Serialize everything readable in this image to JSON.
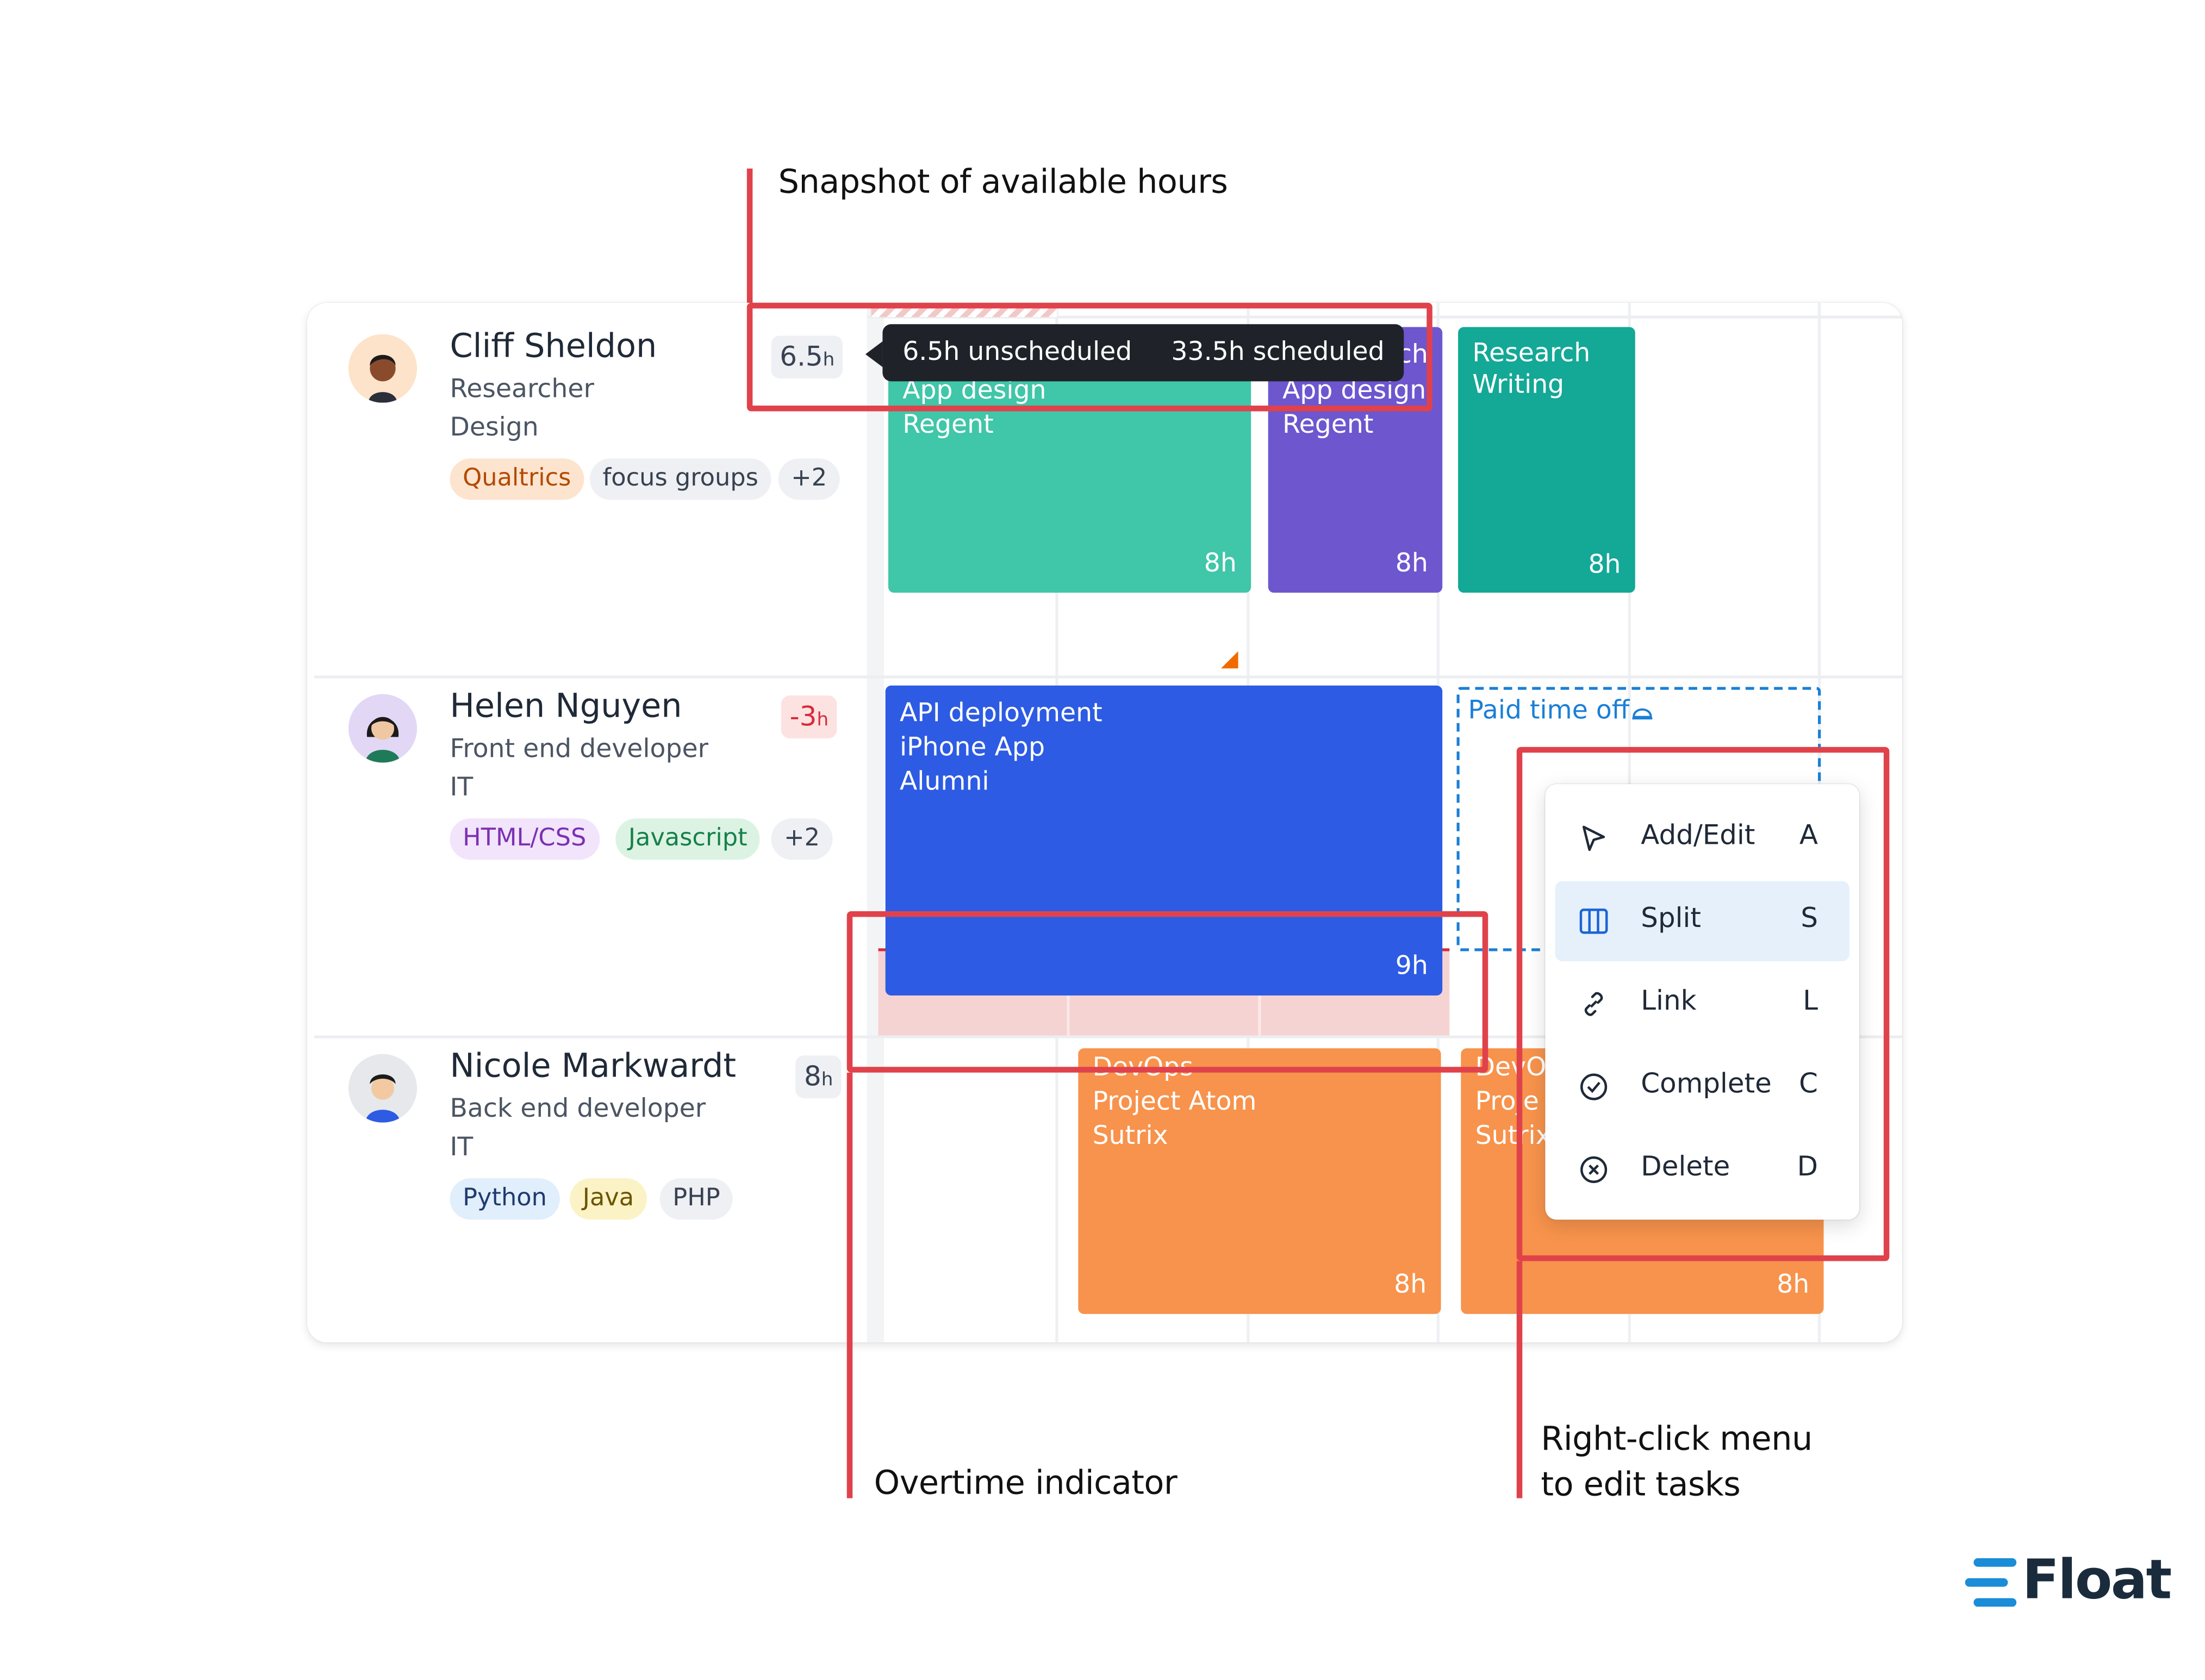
{
  "annotations": {
    "available_hours": "Snapshot of available hours",
    "overtime": "Overtime indicator",
    "right_click_line1": "Right-click menu",
    "right_click_line2": "to edit tasks"
  },
  "tooltip": {
    "unscheduled": "6.5h unscheduled",
    "scheduled": "33.5h scheduled"
  },
  "people": [
    {
      "name": "Cliff Sheldon",
      "role": "Researcher",
      "department": "Design",
      "hours_value": "6.5",
      "hours_unit": "h",
      "tags": [
        "Qualtrics",
        "focus groups",
        "+2"
      ]
    },
    {
      "name": "Helen Nguyen",
      "role": "Front end developer",
      "department": "IT",
      "hours_value": "-3",
      "hours_unit": "h",
      "tags": [
        "HTML/CSS",
        "Javascript",
        "+2"
      ]
    },
    {
      "name": "Nicole Markwardt",
      "role": "Back end developer",
      "department": "IT",
      "hours_value": "8",
      "hours_unit": "h",
      "tags": [
        "Python",
        "Java",
        "PHP"
      ]
    }
  ],
  "tasks": {
    "cliff_1": {
      "line1": "App design",
      "line2": "Regent",
      "hours": "8h",
      "color": "#40c6a8"
    },
    "cliff_2": {
      "line0": "ch",
      "line1": "App design",
      "line2": "Regent",
      "hours": "8h",
      "color": "#6e56cf"
    },
    "cliff_3": {
      "line1": "Research",
      "line2": "Writing",
      "hours": "8h",
      "color": "#14a896"
    },
    "helen_1": {
      "line1": "API deployment",
      "line2": "iPhone App",
      "line3": "Alumni",
      "hours": "9h",
      "color": "#2d5be3"
    },
    "helen_pto": {
      "label": "Paid time off"
    },
    "nicole_1": {
      "line1": "DevOps",
      "line2": "Project Atom",
      "line3": "Sutrix",
      "hours": "8h",
      "color": "#f7934c"
    },
    "nicole_2": {
      "line1": "DevO",
      "line2": "Proje",
      "line3": "Sutrix",
      "hours": "8h",
      "color": "#f7934c"
    }
  },
  "context_menu": {
    "items": [
      {
        "label": "Add/Edit",
        "key": "A",
        "icon": "cursor-arrow-icon"
      },
      {
        "label": "Split",
        "key": "S",
        "icon": "split-columns-icon",
        "active": true
      },
      {
        "label": "Link",
        "key": "L",
        "icon": "link-icon"
      },
      {
        "label": "Complete",
        "key": "C",
        "icon": "check-circle-icon"
      },
      {
        "label": "Delete",
        "key": "D",
        "icon": "x-circle-icon"
      }
    ]
  },
  "logo": {
    "text": "Float"
  },
  "colors": {
    "annotation_red": "#e0424b",
    "overtime_tint": "#f6d3d3",
    "pto_blue": "#1a7fd6",
    "menu_active": "#e5f0fb"
  }
}
